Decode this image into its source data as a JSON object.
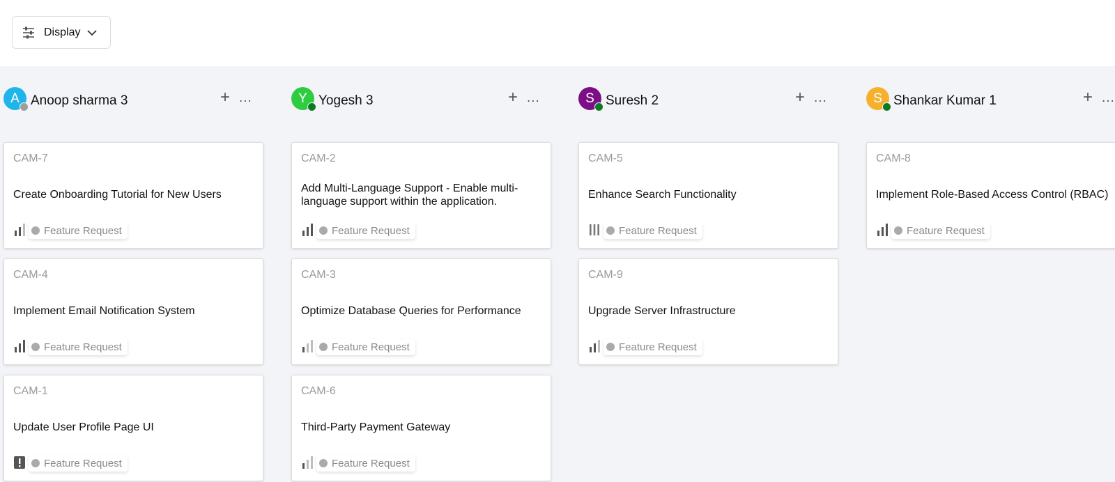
{
  "toolbar": {
    "display_label": "Display",
    "display_icon": "sliders-icon",
    "chevron_icon": "chevron-down-icon"
  },
  "columns": [
    {
      "name": "Anoop sharma 3",
      "initial": "A",
      "avatar_color": "#1fb5ea",
      "status_color": "#9e9e9e",
      "add": "+",
      "more": "...",
      "cards": [
        {
          "id": "CAM-7",
          "title": "Create Onboarding Tutorial for New Users",
          "priority": "medium-priority-icon",
          "tag": "Feature Request"
        },
        {
          "id": "CAM-4",
          "title": "Implement Email Notification System",
          "priority": "high-priority-icon",
          "tag": "Feature Request"
        },
        {
          "id": "CAM-1",
          "title": "Update User Profile Page UI",
          "priority": "urgent-priority-icon",
          "tag": "Feature Request"
        }
      ]
    },
    {
      "name": "Yogesh 3",
      "initial": "Y",
      "avatar_color": "#2ecc40",
      "status_color": "#0b7a22",
      "add": "+",
      "more": "...",
      "cards": [
        {
          "id": "CAM-2",
          "title": "Add Multi-Language Support - Enable multi-language support within the application.",
          "priority": "high-priority-icon",
          "tag": "Feature Request"
        },
        {
          "id": "CAM-3",
          "title": "Optimize Database Queries for Performance",
          "priority": "low-priority-icon",
          "tag": "Feature Request"
        },
        {
          "id": "CAM-6",
          "title": "Third-Party Payment Gateway",
          "priority": "low-priority-icon",
          "tag": "Feature Request"
        }
      ]
    },
    {
      "name": "Suresh 2",
      "initial": "S",
      "avatar_color": "#7d0f86",
      "status_color": "#0b7a22",
      "add": "+",
      "more": "...",
      "cards": [
        {
          "id": "CAM-5",
          "title": "Enhance Search Functionality",
          "priority": "no-priority-icon",
          "tag": "Feature Request"
        },
        {
          "id": "CAM-9",
          "title": "Upgrade Server Infrastructure",
          "priority": "medium-priority-icon",
          "tag": "Feature Request"
        }
      ]
    },
    {
      "name": "Shankar Kumar 1",
      "initial": "S",
      "avatar_color": "#f5b12e",
      "status_color": "#0b7a22",
      "add": "+",
      "more": "...",
      "cards": [
        {
          "id": "CAM-8",
          "title": "Implement Role-Based Access Control (RBAC)",
          "priority": "high-priority-icon",
          "tag": "Feature Request"
        }
      ]
    }
  ]
}
